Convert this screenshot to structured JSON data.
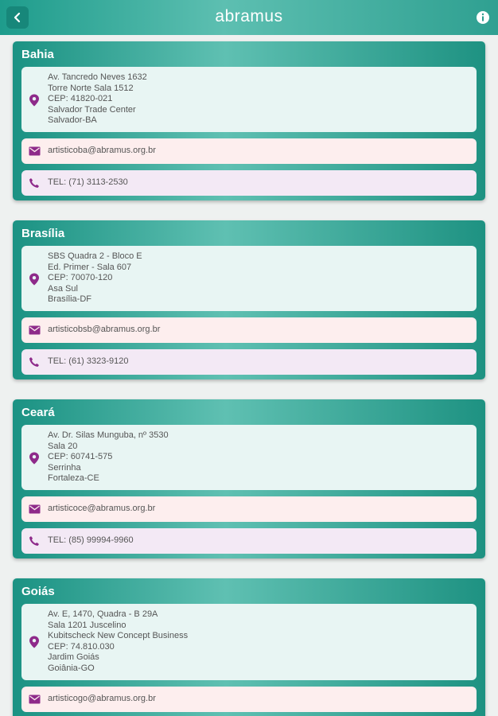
{
  "header": {
    "title": "abramus",
    "back_icon": "chevron-left-icon",
    "info_icon": "info-icon",
    "colors": {
      "bar_start": "#1e9c8c",
      "bar_mid": "#5dbfb1",
      "icon_accent": "#8e2a8a"
    }
  },
  "offices": [
    {
      "state": "Bahia",
      "address": [
        "Av. Tancredo Neves 1632",
        "Torre Norte Sala 1512",
        "CEP: 41820-021",
        "Salvador Trade Center",
        "Salvador-BA"
      ],
      "email": "artisticoba@abramus.org.br",
      "phone": "TEL: (71) 3113-2530"
    },
    {
      "state": "Brasília",
      "address": [
        "SBS Quadra 2 - Bloco E",
        "Ed. Primer - Sala 607",
        "CEP: 70070-120",
        "Asa Sul",
        "Brasília-DF"
      ],
      "email": "artisticobsb@abramus.org.br",
      "phone": "TEL: (61) 3323-9120"
    },
    {
      "state": "Ceará",
      "address": [
        "Av. Dr. Silas Munguba, nº 3530",
        "Sala 20",
        "CEP: 60741-575",
        "Serrinha",
        "Fortaleza-CE"
      ],
      "email": "artisticoce@abramus.org.br",
      "phone": "TEL: (85) 99994-9960"
    },
    {
      "state": "Goiás",
      "address": [
        "Av. E, 1470, Quadra - B 29A",
        "Sala 1201 Juscelino",
        "Kubitscheck New Concept Business",
        "CEP: 74.810.030",
        "Jardim Goiás",
        "Goiânia-GO"
      ],
      "email": "artisticogo@abramus.org.br",
      "phone": ""
    }
  ]
}
